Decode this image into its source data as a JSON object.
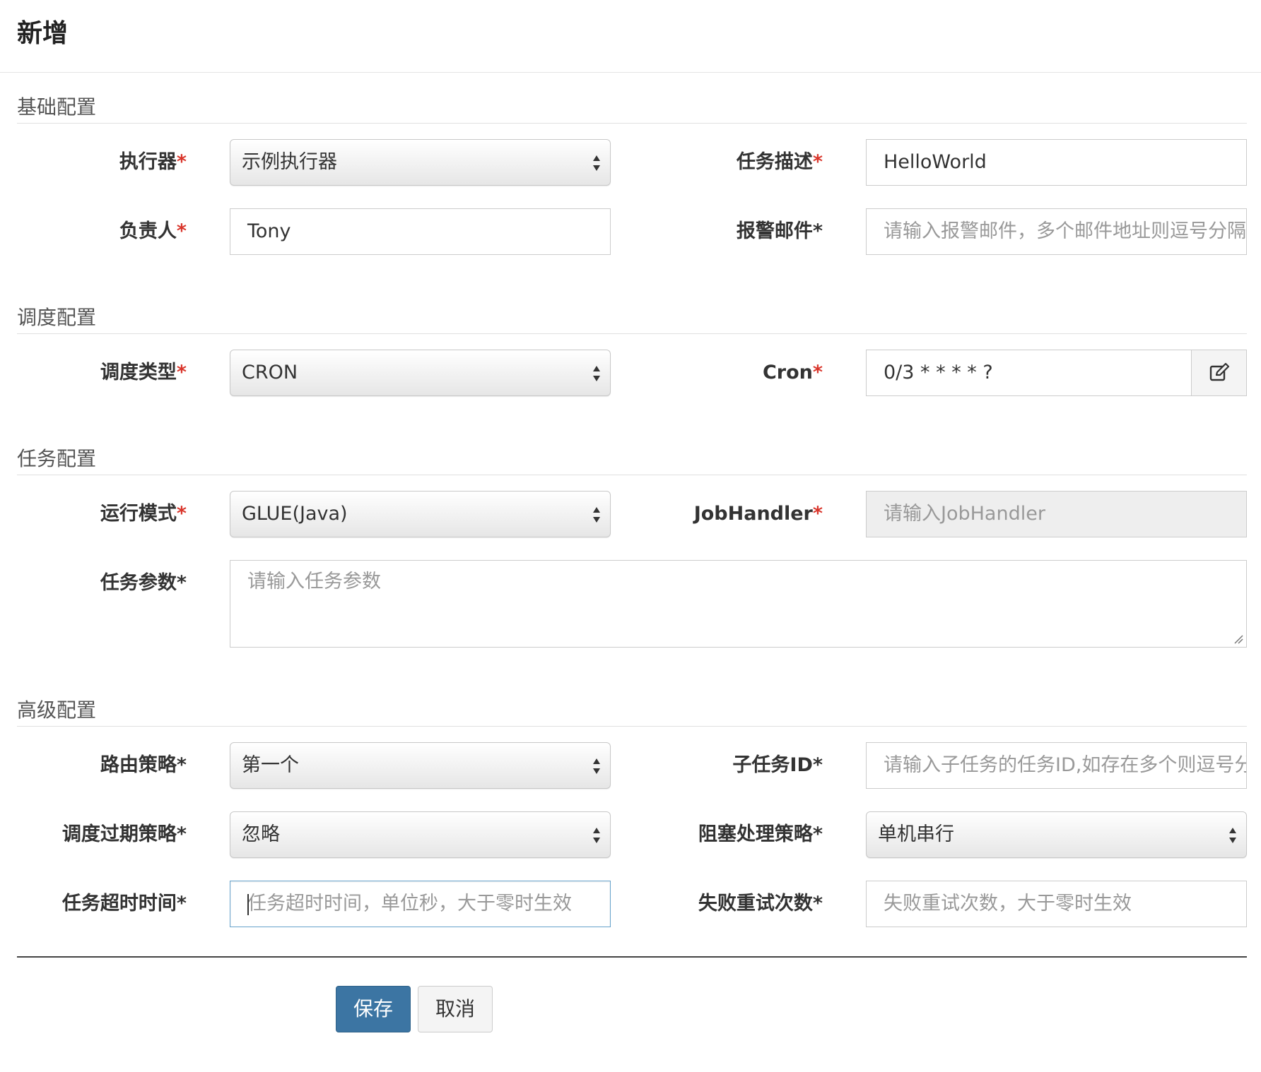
{
  "dialog": {
    "title": "新增"
  },
  "sections": {
    "basic": "基础配置",
    "schedule": "调度配置",
    "task": "任务配置",
    "advanced": "高级配置"
  },
  "fields": {
    "executor": {
      "label": "执行器",
      "value": "示例执行器"
    },
    "job_desc": {
      "label": "任务描述",
      "value": "HelloWorld"
    },
    "author": {
      "label": "负责人",
      "value": "Tony"
    },
    "alarm_email": {
      "label": "报警邮件",
      "placeholder": "请输入报警邮件，多个邮件地址则逗号分隔"
    },
    "schedule_type": {
      "label": "调度类型",
      "value": "CRON"
    },
    "cron": {
      "label": "Cron",
      "value": "0/3 * * * * ?"
    },
    "glue_type": {
      "label": "运行模式",
      "value": "GLUE(Java)"
    },
    "job_handler": {
      "label": "JobHandler",
      "placeholder": "请输入JobHandler"
    },
    "job_param": {
      "label": "任务参数",
      "placeholder": "请输入任务参数"
    },
    "route_strategy": {
      "label": "路由策略",
      "value": "第一个"
    },
    "child_job_id": {
      "label": "子任务ID",
      "placeholder": "请输入子任务的任务ID,如存在多个则逗号分隔"
    },
    "misfire_strategy": {
      "label": "调度过期策略",
      "value": "忽略"
    },
    "block_strategy": {
      "label": "阻塞处理策略",
      "value": "单机串行"
    },
    "timeout": {
      "label": "任务超时时间",
      "placeholder": "任务超时时间，单位秒，大于零时生效"
    },
    "fail_retry": {
      "label": "失败重试次数",
      "placeholder": "失败重试次数，大于零时生效"
    }
  },
  "required_mark": "*",
  "buttons": {
    "save": "保存",
    "cancel": "取消"
  },
  "colors": {
    "required": "#d9352b",
    "primary": "#3c75a3"
  }
}
